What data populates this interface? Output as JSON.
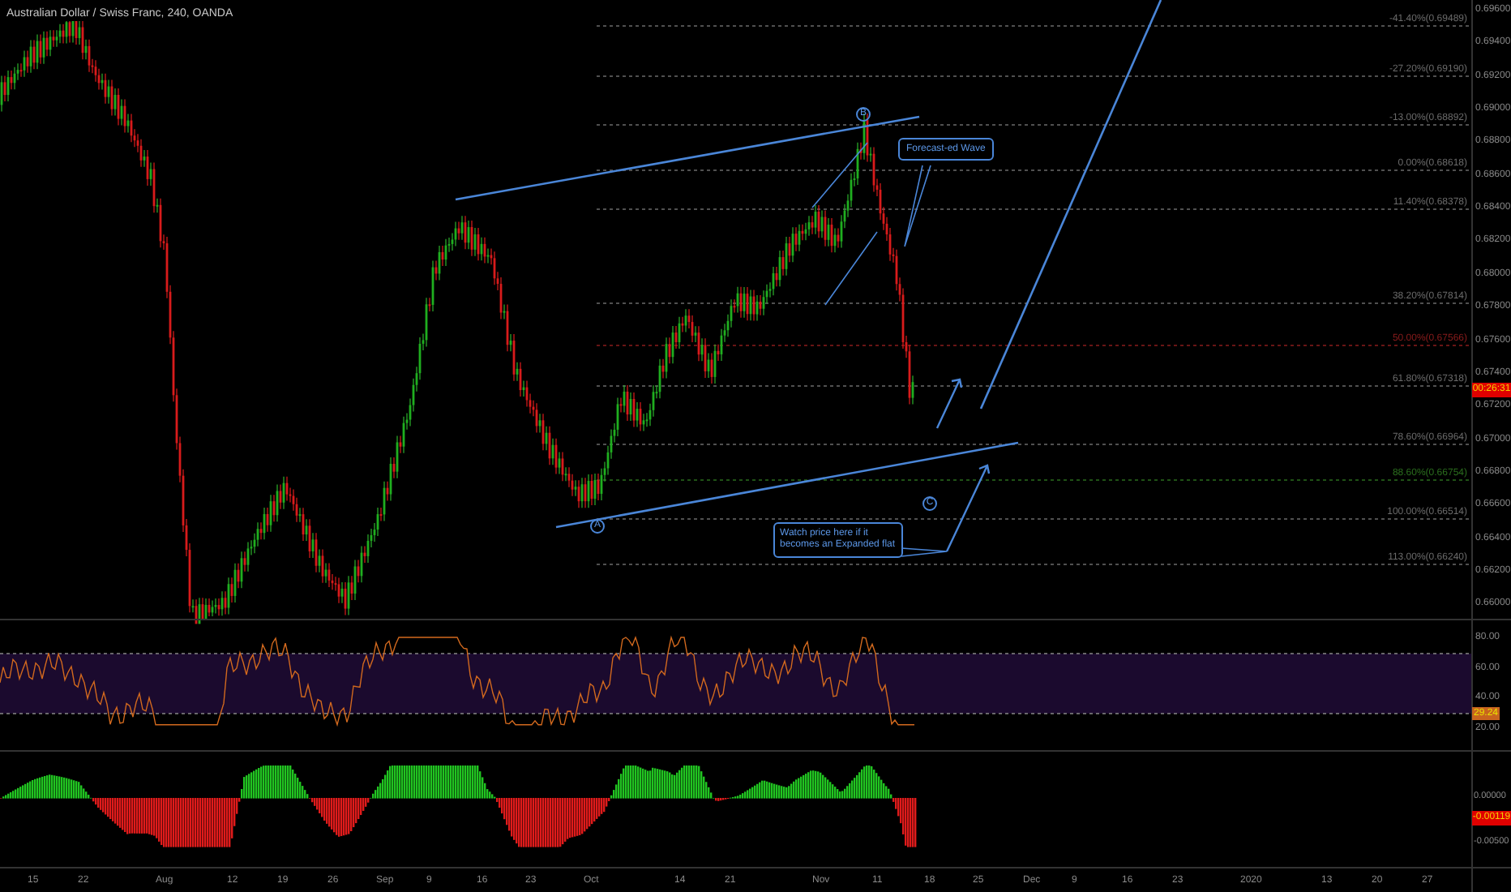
{
  "title": "Australian Dollar / Swiss Franc, 240, OANDA",
  "price_axis": {
    "ticks": [
      "0.69600",
      "0.69400",
      "0.69200",
      "0.69000",
      "0.68800",
      "0.68600",
      "0.68400",
      "0.68200",
      "0.68000",
      "0.67800",
      "0.67600",
      "0.67400",
      "0.67200",
      "0.67000",
      "0.66800",
      "0.66600",
      "0.66400",
      "0.66200",
      "0.66000"
    ],
    "current_badge": "00:26:31"
  },
  "fib_levels": [
    {
      "label": "-41.40%(0.69489)",
      "color": "#6b6b6b"
    },
    {
      "label": "-27.20%(0.69190)",
      "color": "#6b6b6b"
    },
    {
      "label": "-13.00%(0.68892)",
      "color": "#6b6b6b"
    },
    {
      "label": "0.00%(0.68618)",
      "color": "#6b6b6b"
    },
    {
      "label": "11.40%(0.68378)",
      "color": "#6b6b6b"
    },
    {
      "label": "38.20%(0.67814)",
      "color": "#6b6b6b"
    },
    {
      "label": "50.00%(0.67566)",
      "color": "#8b1c1c"
    },
    {
      "label": "61.80%(0.67318)",
      "color": "#6b6b6b"
    },
    {
      "label": "78.60%(0.66964)",
      "color": "#6b6b6b"
    },
    {
      "label": "88.60%(0.66754)",
      "color": "#2b6e1e"
    },
    {
      "label": "100.00%(0.66514)",
      "color": "#6b6b6b"
    },
    {
      "label": "113.00%(0.66240)",
      "color": "#6b6b6b"
    }
  ],
  "annotations": [
    {
      "text": "Forecast-ed Wave"
    },
    {
      "text": "Watch price here if it becomes an Expanded flat"
    }
  ],
  "wave_labels": [
    "A",
    "B",
    "C"
  ],
  "rsi": {
    "ticks": [
      "80.00",
      "60.00",
      "40.00",
      "20.00"
    ],
    "badge": "29.24"
  },
  "macd": {
    "ticks": [
      "0.00000",
      "-0.00500"
    ],
    "badge": "-0.00119"
  },
  "time_axis": [
    "15",
    "22",
    "Aug",
    "12",
    "19",
    "26",
    "Sep",
    "9",
    "16",
    "23",
    "Oct",
    "14",
    "21",
    "Nov",
    "11",
    "18",
    "25",
    "Dec",
    "9",
    "16",
    "23",
    "2020",
    "13",
    "20",
    "27"
  ]
}
